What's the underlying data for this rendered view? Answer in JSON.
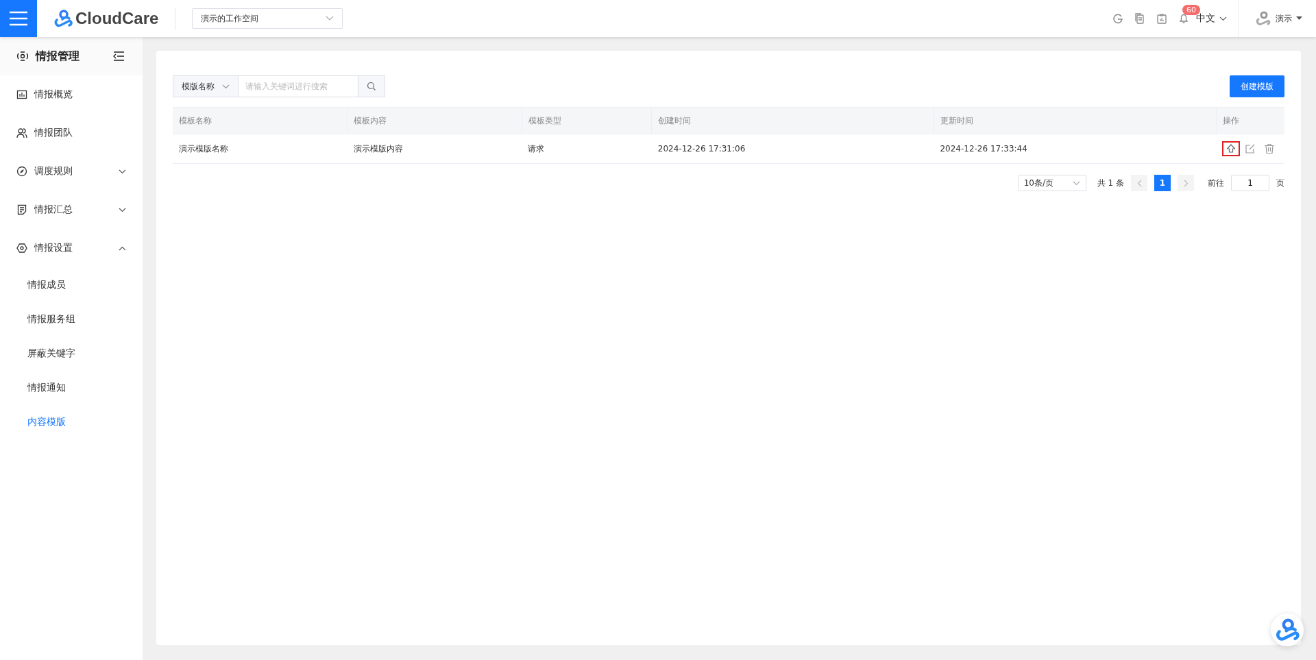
{
  "topbar": {
    "brand": "CloudCare",
    "workspace": "演示的工作空间",
    "notification_count": "60",
    "language": "中文",
    "user": "演示"
  },
  "sidebar": {
    "title": "情报管理",
    "items": [
      {
        "label": "情报概览",
        "selected": false
      },
      {
        "label": "情报团队",
        "selected": false
      },
      {
        "label": "调度规则",
        "expanded": false,
        "selected": false
      },
      {
        "label": "情报汇总",
        "expanded": false,
        "selected": false
      },
      {
        "label": "情报设置",
        "expanded": true,
        "selected": false,
        "children": [
          {
            "label": "情报成员",
            "selected": false
          },
          {
            "label": "情报服务组",
            "selected": false
          },
          {
            "label": "屏蔽关键字",
            "selected": false
          },
          {
            "label": "情报通知",
            "selected": false
          },
          {
            "label": "内容模版",
            "selected": true
          }
        ]
      }
    ]
  },
  "search": {
    "field": "模版名称",
    "placeholder": "请输入关键词进行搜索"
  },
  "create_button": "创建模版",
  "table": {
    "columns": [
      "模板名称",
      "模板内容",
      "模板类型",
      "创建时间",
      "更新时间",
      "操作"
    ],
    "rows": [
      {
        "cells": [
          "演示模版名称",
          "演示模版内容",
          "请求",
          "2024-12-26 17:31:06",
          "2024-12-26 17:33:44"
        ],
        "actions": [
          {
            "kind": "upload",
            "highlighted": true
          },
          {
            "kind": "edit",
            "highlighted": false
          },
          {
            "kind": "delete",
            "highlighted": false
          }
        ]
      }
    ]
  },
  "pagination": {
    "page_size": "10条/页",
    "total": "共 1 条",
    "pages": [
      {
        "label": "1",
        "selected": true
      }
    ],
    "goto_label": "前往",
    "goto_value": "1",
    "page_suffix": "页"
  }
}
